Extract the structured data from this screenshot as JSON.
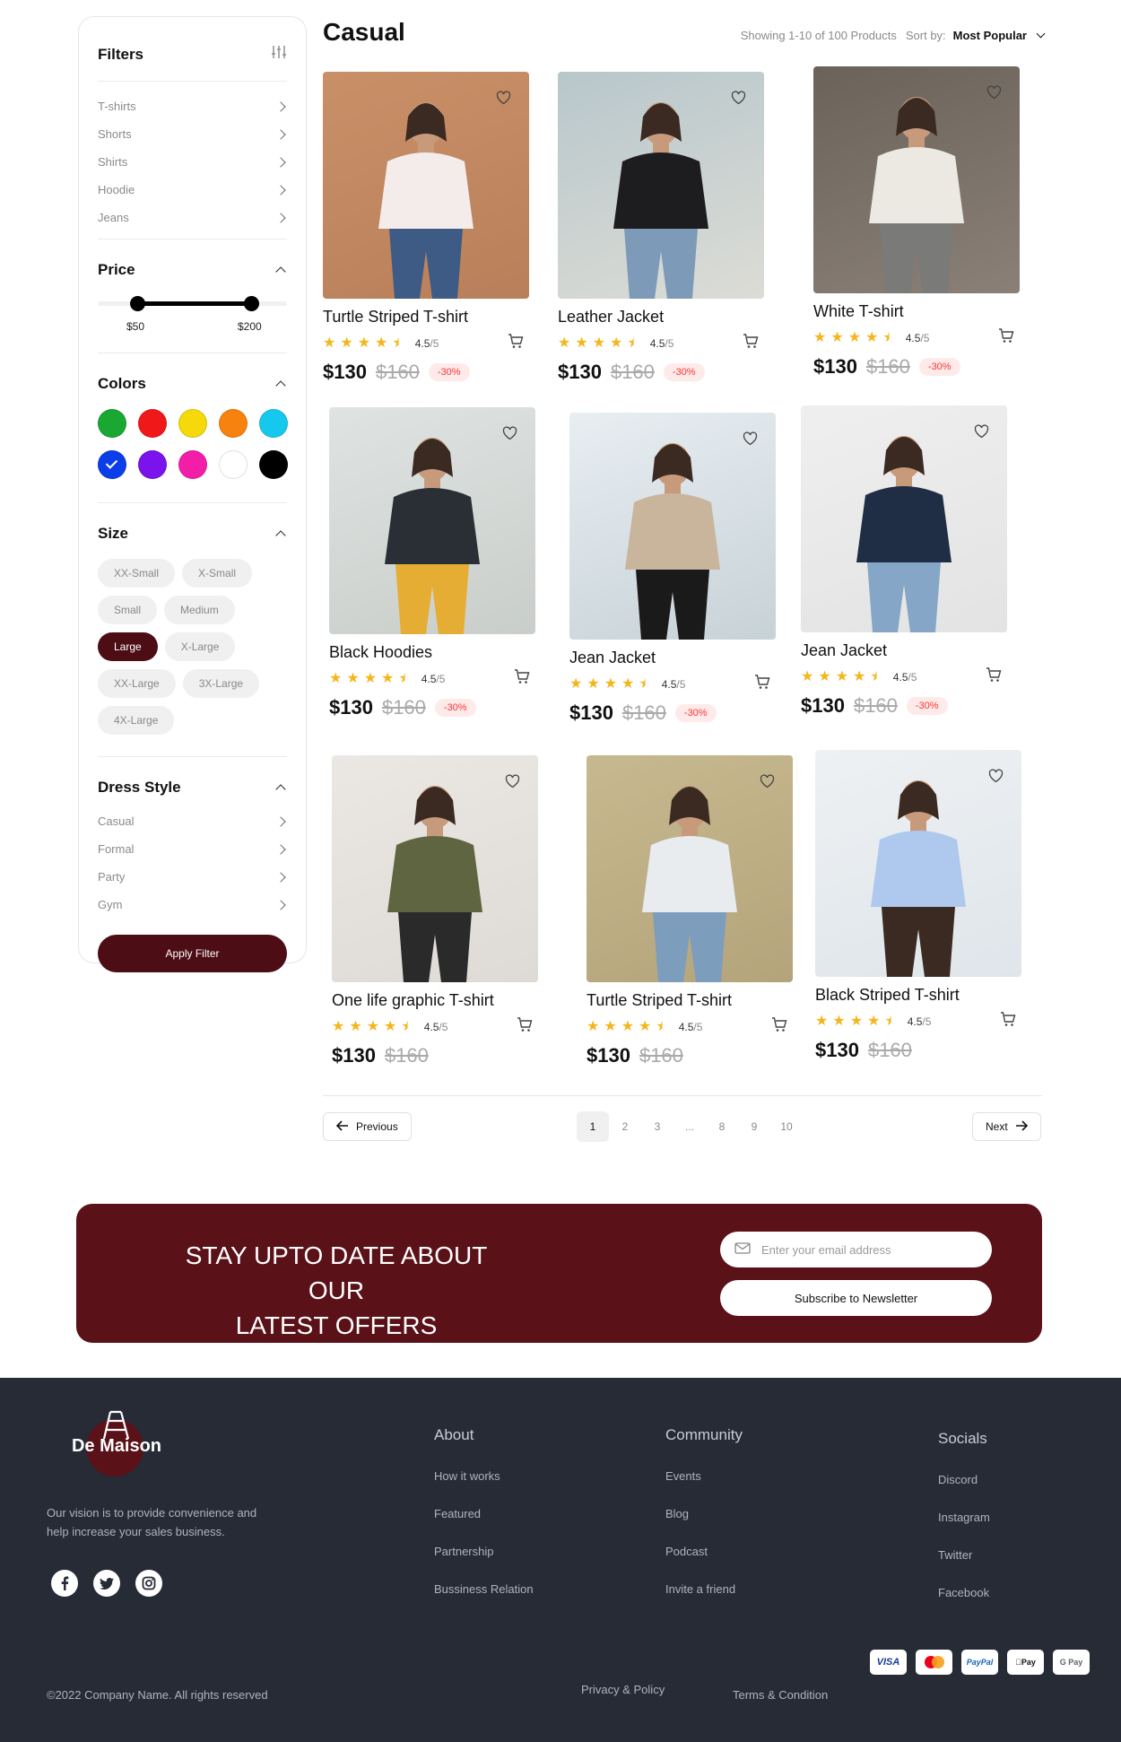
{
  "sidebar": {
    "title": "Filters",
    "categories": [
      "T-shirts",
      "Shorts",
      "Shirts",
      "Hoodie",
      "Jeans"
    ],
    "price": {
      "title": "Price",
      "min_label": "$50",
      "max_label": "$200"
    },
    "colors": {
      "title": "Colors",
      "swatches": [
        "#1aa832",
        "#f01818",
        "#f5d90a",
        "#f7830e",
        "#17c8ee",
        "#0b3ee8",
        "#7a13ec",
        "#f21ea8",
        "#ffffff",
        "#000000"
      ],
      "selected": "#0b3ee8"
    },
    "size": {
      "title": "Size",
      "options": [
        "XX-Small",
        "X-Small",
        "Small",
        "Medium",
        "Large",
        "X-Large",
        "XX-Large",
        "3X-Large",
        "4X-Large"
      ],
      "selected": "Large"
    },
    "dress_style": {
      "title": "Dress Style",
      "items": [
        "Casual",
        "Formal",
        "Party",
        "Gym"
      ]
    },
    "apply_label": "Apply Filter"
  },
  "header": {
    "title": "Casual",
    "showing": "Showing 1-10 of 100 Products",
    "sort_label": "Sort by:",
    "sort_value": "Most Popular"
  },
  "products": [
    {
      "name": "Turtle Striped T-shirt",
      "rating": "4.5",
      "rating_den": "/5",
      "price": "$130",
      "old_price": "$160",
      "discount": "-30%"
    },
    {
      "name": "Leather Jacket",
      "rating": "4.5",
      "rating_den": "/5",
      "price": "$130",
      "old_price": "$160",
      "discount": "-30%"
    },
    {
      "name": "White T-shirt",
      "rating": "4.5",
      "rating_den": "/5",
      "price": "$130",
      "old_price": "$160",
      "discount": "-30%"
    },
    {
      "name": "Black Hoodies",
      "rating": "4.5",
      "rating_den": "/5",
      "price": "$130",
      "old_price": "$160",
      "discount": "-30%"
    },
    {
      "name": "Jean Jacket",
      "rating": "4.5",
      "rating_den": "/5",
      "price": "$130",
      "old_price": "$160",
      "discount": "-30%"
    },
    {
      "name": "Jean Jacket",
      "rating": "4.5",
      "rating_den": "/5",
      "price": "$130",
      "old_price": "$160",
      "discount": "-30%"
    },
    {
      "name": "One life graphic T-shirt",
      "rating": "4.5",
      "rating_den": "/5",
      "price": "$130",
      "old_price": "$160",
      "discount": ""
    },
    {
      "name": "Turtle Striped T-shirt",
      "rating": "4.5",
      "rating_den": "/5",
      "price": "$130",
      "old_price": "$160",
      "discount": ""
    },
    {
      "name": "Black Striped T-shirt",
      "rating": "4.5",
      "rating_den": "/5",
      "price": "$130",
      "old_price": "$160",
      "discount": ""
    }
  ],
  "pagination": {
    "previous": "Previous",
    "next": "Next",
    "pages": [
      "1",
      "2",
      "3",
      "...",
      "8",
      "9",
      "10"
    ],
    "current": "1"
  },
  "newsletter": {
    "title_line1": "STAY UPTO DATE ABOUT OUR",
    "title_line2": "LATEST OFFERS",
    "placeholder": "Enter your email address",
    "button": "Subscribe to Newsletter"
  },
  "footer": {
    "brand": "De Maison",
    "tagline": "Our vision is to provide convenience and help increase your sales business.",
    "socials": [
      "facebook-icon",
      "twitter-icon",
      "instagram-icon"
    ],
    "columns": [
      {
        "title": "About",
        "links": [
          "How it works",
          "Featured",
          "Partnership",
          "Bussiness Relation"
        ]
      },
      {
        "title": "Community",
        "links": [
          "Events",
          "Blog",
          "Podcast",
          "Invite a friend"
        ]
      },
      {
        "title": "Socials",
        "links": [
          "Discord",
          "Instagram",
          "Twitter",
          "Facebook"
        ]
      }
    ],
    "copyright": "©2022 Company Name. All rights reserved",
    "privacy": "Privacy & Policy",
    "terms": "Terms & Condition",
    "payments": [
      "VISA",
      "Mastercard",
      "PayPal",
      "Apple Pay",
      "G Pay"
    ]
  }
}
